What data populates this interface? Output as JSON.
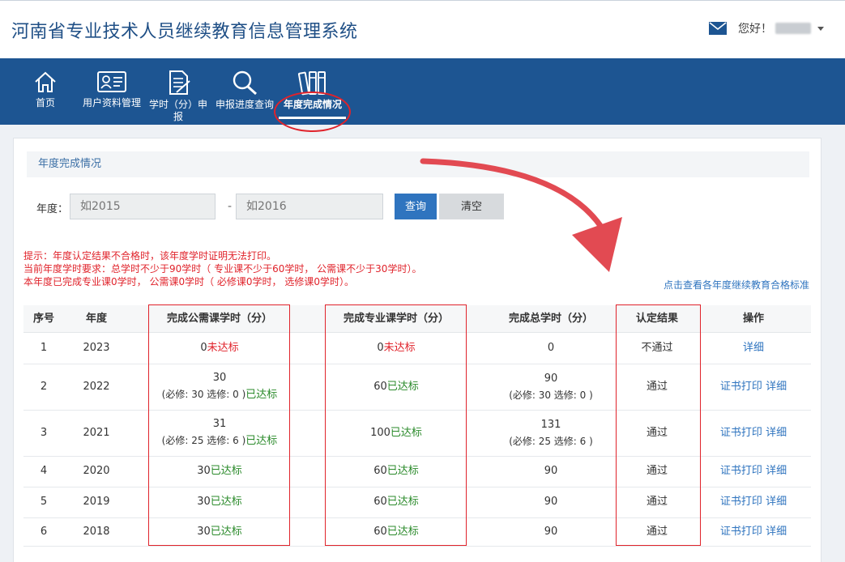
{
  "header": {
    "title": "河南省专业技术人员继续教育信息管理系统",
    "greeting": "您好！"
  },
  "nav": [
    {
      "label": "首页",
      "icon": "home-icon"
    },
    {
      "label": "用户资料管理",
      "icon": "id-card-icon"
    },
    {
      "label": "学时（分）申\n报",
      "icon": "document-icon"
    },
    {
      "label": "申报进度查询",
      "icon": "magnifier-icon"
    },
    {
      "label": "年度完成情况",
      "icon": "binders-icon"
    }
  ],
  "panel": {
    "heading": "年度完成情况",
    "year_label": "年度：",
    "from_placeholder": "如2015",
    "to_placeholder": "如2016",
    "dash": "-",
    "query_label": "查询",
    "clear_label": "清空"
  },
  "hints": [
    "提示：年度认定结果不合格时，该年度学时证明无法打印。",
    "当前年度学时要求：总学时不少于90学时（ 专业课不少于60学时， 公需课不少于30学时）。",
    "本年度已完成专业课0学时， 公需课0学时（ 必修课0学时， 选修课0学时）。"
  ],
  "standard_link": "点击查看各年度继续教育合格标准",
  "table": {
    "headers": [
      "序号",
      "年度",
      "完成公需课学时（分）",
      "完成专业课学时（分）",
      "完成总学时（分）",
      "认定结果",
      "操作"
    ],
    "rows": [
      {
        "no": "1",
        "year": "2023",
        "pub": "0",
        "pub_detail": "",
        "pub_status": "未达标",
        "pub_ok": false,
        "pro": "0",
        "pro_status": "未达标",
        "pro_ok": false,
        "total": "0",
        "total_detail": "",
        "result": "不通过",
        "print": "",
        "detail": "详细"
      },
      {
        "no": "2",
        "year": "2022",
        "pub": "30",
        "pub_detail": "(必修: 30 选修: 0 )",
        "pub_status": "已达标",
        "pub_ok": true,
        "pro": "60",
        "pro_status": "已达标",
        "pro_ok": true,
        "total": "90",
        "total_detail": "(必修: 30 选修: 0 )",
        "result": "通过",
        "print": "证书打印",
        "detail": "详细"
      },
      {
        "no": "3",
        "year": "2021",
        "pub": "31",
        "pub_detail": "(必修: 25 选修: 6 )",
        "pub_status": "已达标",
        "pub_ok": true,
        "pro": "100",
        "pro_status": "已达标",
        "pro_ok": true,
        "total": "131",
        "total_detail": "(必修: 25 选修: 6 )",
        "result": "通过",
        "print": "证书打印",
        "detail": "详细"
      },
      {
        "no": "4",
        "year": "2020",
        "pub": "30",
        "pub_detail": "",
        "pub_status": "已达标",
        "pub_ok": true,
        "pro": "60",
        "pro_status": "已达标",
        "pro_ok": true,
        "total": "90",
        "total_detail": "",
        "result": "通过",
        "print": "证书打印",
        "detail": "详细"
      },
      {
        "no": "5",
        "year": "2019",
        "pub": "30",
        "pub_detail": "",
        "pub_status": "已达标",
        "pub_ok": true,
        "pro": "60",
        "pro_status": "已达标",
        "pro_ok": true,
        "total": "90",
        "total_detail": "",
        "result": "通过",
        "print": "证书打印",
        "detail": "详细"
      },
      {
        "no": "6",
        "year": "2018",
        "pub": "30",
        "pub_detail": "",
        "pub_status": "已达标",
        "pub_ok": true,
        "pro": "60",
        "pro_status": "已达标",
        "pro_ok": true,
        "total": "90",
        "total_detail": "",
        "result": "通过",
        "print": "证书打印",
        "detail": "详细"
      }
    ]
  },
  "colors": {
    "brand": "#1d5592",
    "accent": "#2f74bf",
    "danger": "#e0232b",
    "success": "#2a8a2a"
  }
}
